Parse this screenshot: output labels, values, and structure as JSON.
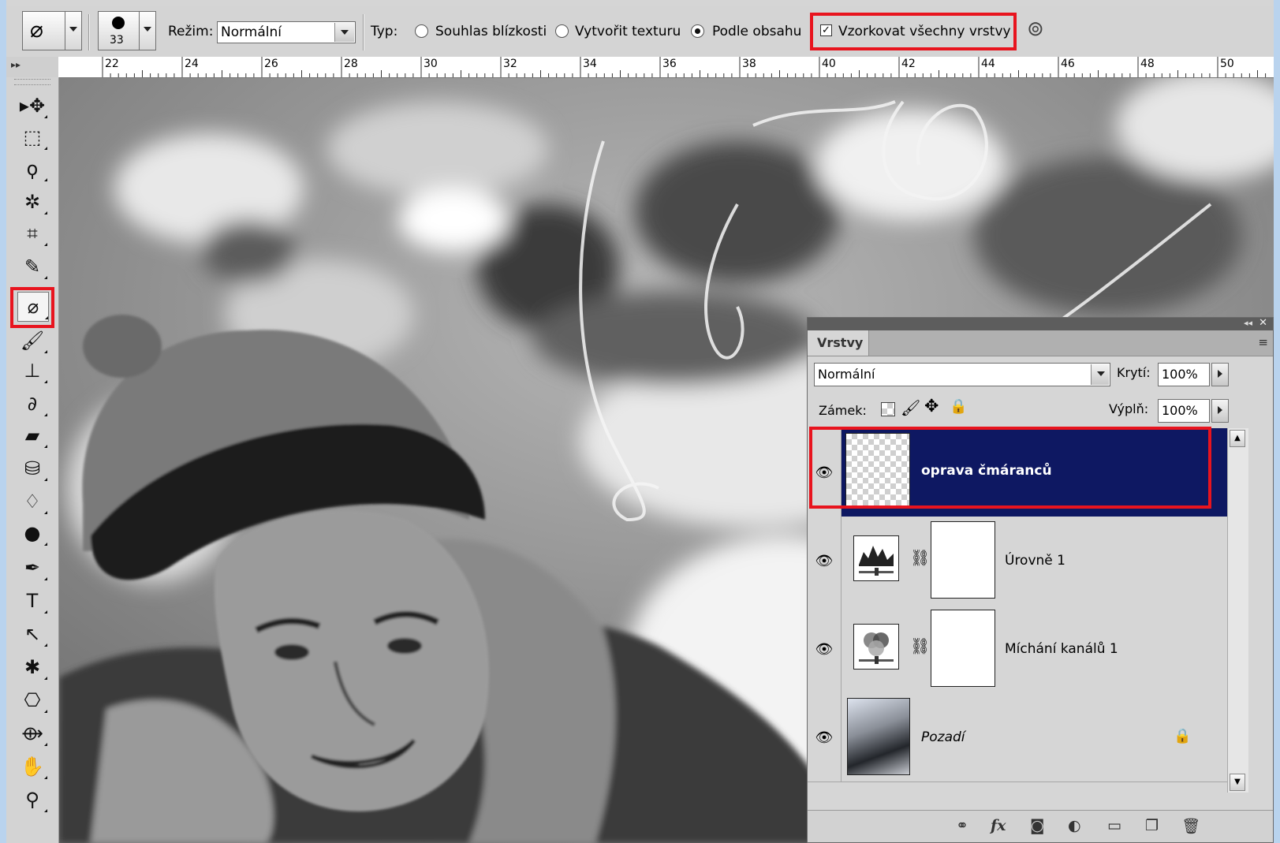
{
  "options_bar": {
    "brush_size": "33",
    "mode_label": "Režim:",
    "mode_value": "Normální",
    "type_label": "Typ:",
    "type_options": [
      {
        "label": "Souhlas blízkosti",
        "selected": false
      },
      {
        "label": "Vytvořit texturu",
        "selected": false
      },
      {
        "label": "Podle obsahu",
        "selected": true
      }
    ],
    "sample_all_layers_label": "Vzorkovat všechny vrstvy",
    "sample_all_layers_checked": true
  },
  "ruler": {
    "labels": [
      "22",
      "24",
      "26",
      "28",
      "30",
      "32",
      "34",
      "36",
      "38",
      "40",
      "42",
      "44",
      "46",
      "48",
      "50"
    ]
  },
  "toolbox": {
    "tools": [
      {
        "icon": "move-icon",
        "glyph": "▸✥"
      },
      {
        "icon": "marquee-icon",
        "glyph": "⬚"
      },
      {
        "icon": "lasso-icon",
        "glyph": "ϙ"
      },
      {
        "icon": "magic-wand-icon",
        "glyph": "✲"
      },
      {
        "icon": "crop-icon",
        "glyph": "⌗"
      },
      {
        "icon": "eyedropper-icon",
        "glyph": "✎"
      },
      {
        "icon": "spot-healing-brush-icon",
        "glyph": "⌀",
        "active": true
      },
      {
        "icon": "brush-icon",
        "glyph": "🖌"
      },
      {
        "icon": "clone-stamp-icon",
        "glyph": "⊥"
      },
      {
        "icon": "history-brush-icon",
        "glyph": "∂"
      },
      {
        "icon": "eraser-icon",
        "glyph": "▰"
      },
      {
        "icon": "paint-bucket-icon",
        "glyph": "⛁"
      },
      {
        "icon": "blur-icon",
        "glyph": "♢"
      },
      {
        "icon": "dodge-icon",
        "glyph": "●"
      },
      {
        "icon": "pen-icon",
        "glyph": "✒"
      },
      {
        "icon": "type-icon",
        "glyph": "T"
      },
      {
        "icon": "path-selection-icon",
        "glyph": "↖"
      },
      {
        "icon": "custom-shape-icon",
        "glyph": "✱"
      },
      {
        "icon": "3d-rotate-icon",
        "glyph": "⎔"
      },
      {
        "icon": "3d-orbit-icon",
        "glyph": "⟴"
      },
      {
        "icon": "hand-icon",
        "glyph": "✋"
      },
      {
        "icon": "zoom-icon",
        "glyph": "⚲"
      }
    ]
  },
  "layers_panel": {
    "tab_label": "Vrstvy",
    "blend_mode": "Normální",
    "opacity_label": "Krytí:",
    "opacity_value": "100%",
    "lock_label": "Zámek:",
    "fill_label": "Výplň:",
    "fill_value": "100%",
    "layers": [
      {
        "name": "oprava čmáranců",
        "selected": true,
        "kind": "pixel-transparent"
      },
      {
        "name": "Úrovně 1",
        "selected": false,
        "kind": "levels-adjustment"
      },
      {
        "name": "Míchání kanálů 1",
        "selected": false,
        "kind": "channel-mixer-adjustment"
      },
      {
        "name": "Pozadí",
        "selected": false,
        "kind": "background",
        "locked": true
      }
    ]
  },
  "colors": {
    "highlight_red": "#e8141e",
    "selected_layer_bg": "#0e1862"
  }
}
